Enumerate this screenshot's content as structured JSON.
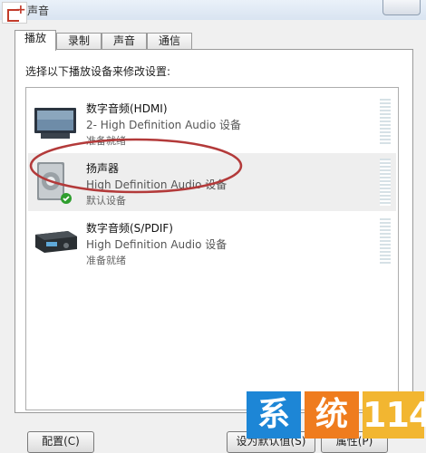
{
  "window": {
    "title": "声音"
  },
  "tabs": [
    {
      "label": "播放",
      "active": true
    },
    {
      "label": "录制",
      "active": false
    },
    {
      "label": "声音",
      "active": false
    },
    {
      "label": "通信",
      "active": false
    }
  ],
  "instruction": "选择以下播放设备来修改设置:",
  "devices": [
    {
      "name": "数字音频(HDMI)",
      "driver": "2- High Definition Audio 设备",
      "status": "准备就绪",
      "icon": "monitor-icon",
      "selected": false
    },
    {
      "name": "扬声器",
      "driver": "High Definition Audio 设备",
      "status": "默认设备",
      "icon": "speaker-icon",
      "selected": true,
      "default": true
    },
    {
      "name": "数字音频(S/PDIF)",
      "driver": "High Definition Audio 设备",
      "status": "准备就绪",
      "icon": "receiver-icon",
      "selected": false
    }
  ],
  "buttons": {
    "configure": "配置(C)",
    "set_default": "设为默认值(S)",
    "properties": "属性(P)"
  },
  "watermark": {
    "char1": "系",
    "char2": "统",
    "number": "114"
  },
  "colors": {
    "highlight_ellipse": "#b33a3a",
    "default_check": "#2e9e2e",
    "watermark_blue": "#1d86d6",
    "watermark_orange": "#ef7c1e",
    "watermark_yellow": "#f2b631"
  }
}
